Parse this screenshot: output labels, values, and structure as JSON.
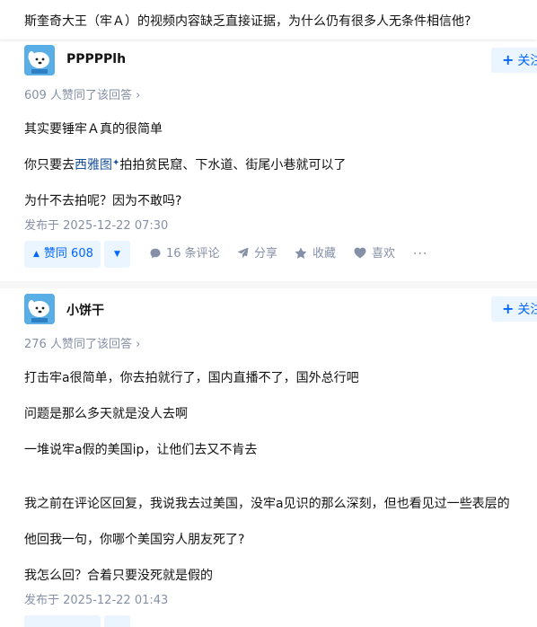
{
  "question": {
    "title": "斯奎奇大王（牢Ａ）的视频内容缺乏直接证据，为什么仍有很多人无条件相信他?"
  },
  "answers": [
    {
      "author": "PPPPPlh",
      "follow_label": "关注",
      "upvote_text": "609 人赞同了该回答 ›",
      "paragraphs": {
        "p1": "其实要锤牢Ａ真的很简单",
        "p2_before": "你只要去",
        "p2_link": "西雅图",
        "p2_after": "拍拍贫民窟、下水道、街尾小巷就可以了",
        "p3": "为什不去拍呢？因为不敢吗?"
      },
      "published": "发布于 2025-12-22 07:30",
      "actions": {
        "upvote_label": "赞同 608",
        "comments": "16 条评论",
        "share": "分享",
        "favorite": "收藏",
        "like": "喜欢",
        "more": "···"
      }
    },
    {
      "author": "小饼干",
      "follow_label": "关注",
      "upvote_text": "276 人赞同了该回答 ›",
      "paragraphs": {
        "p1": "打击牢a很简单，你去拍就行了，国内直播不了，国外总行吧",
        "p2": "问题是那么多天就是没人去啊",
        "p3": "一堆说牢a假的美国ip，让他们去又不肯去",
        "p4": "我之前在评论区回复，我说我去过美国，没牢a见识的那么深刻，但也看见过一些表层的",
        "p5": "他回我一句，你哪个美国穷人朋友死了?",
        "p6": "我怎么回？合着只要没死就是假的"
      },
      "published": "发布于 2025-12-22 01:43"
    }
  ],
  "icons": {
    "sparkle": "✦",
    "plus": "+",
    "up_arrow": "▲",
    "down_arrow": "▼"
  },
  "colors": {
    "accent": "#0066ff",
    "accent_bg": "#ebf5ff",
    "meta_gray": "#8590a6",
    "link": "#175199"
  }
}
